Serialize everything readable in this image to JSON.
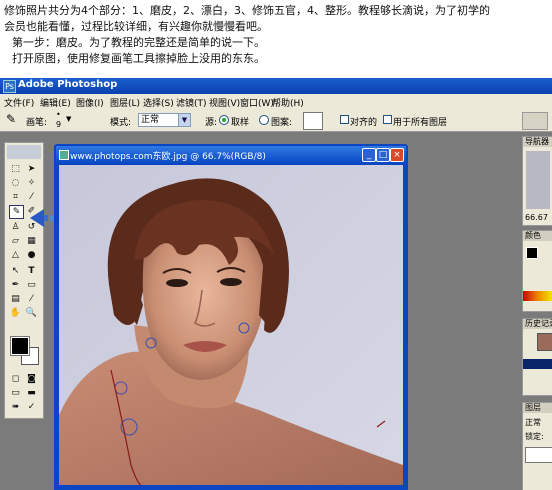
{
  "intro": {
    "line1": "修饰照片共分为4个部分：1、磨皮，2、漂白，3、修饰五官，4、整形。教程够长滴说，为了初学的",
    "line2": "会员也能看懂，过程比较详细，有兴趣你就慢慢看吧。",
    "line3": "第一步：磨皮。为了教程的完整还是简单的说一下。",
    "line4": "打开原图，使用修复画笔工具擦掉脸上没用的东东。"
  },
  "app": {
    "title": "Adobe Photoshop",
    "menu": [
      "文件(F)",
      "编辑(E)",
      "图像(I)",
      "图层(L)",
      "选择(S)",
      "滤镜(T)",
      "视图(V)",
      "窗口(W)",
      "帮助(H)"
    ]
  },
  "options": {
    "brush_label": "画笔:",
    "brush_size": "9",
    "mode_label": "模式:",
    "mode_value": "正常",
    "source_label": "源:",
    "sampled_label": "取样",
    "pattern_label": "图案:",
    "aligned_label": "对齐的",
    "all_layers_label": "用于所有图层"
  },
  "document": {
    "title": "www.photops.com东欧.jpg @ 66.7%(RGB/8)"
  },
  "panels": {
    "navigator": "导航器",
    "zoom": "66.67",
    "color": "颜色",
    "history": "历史记录",
    "layers": "图层",
    "layer_mode": "正常",
    "lock_label": "锁定:"
  },
  "colors": {
    "accent": "#0b46c2",
    "foreground": "#000000",
    "background": "#ffffff"
  }
}
